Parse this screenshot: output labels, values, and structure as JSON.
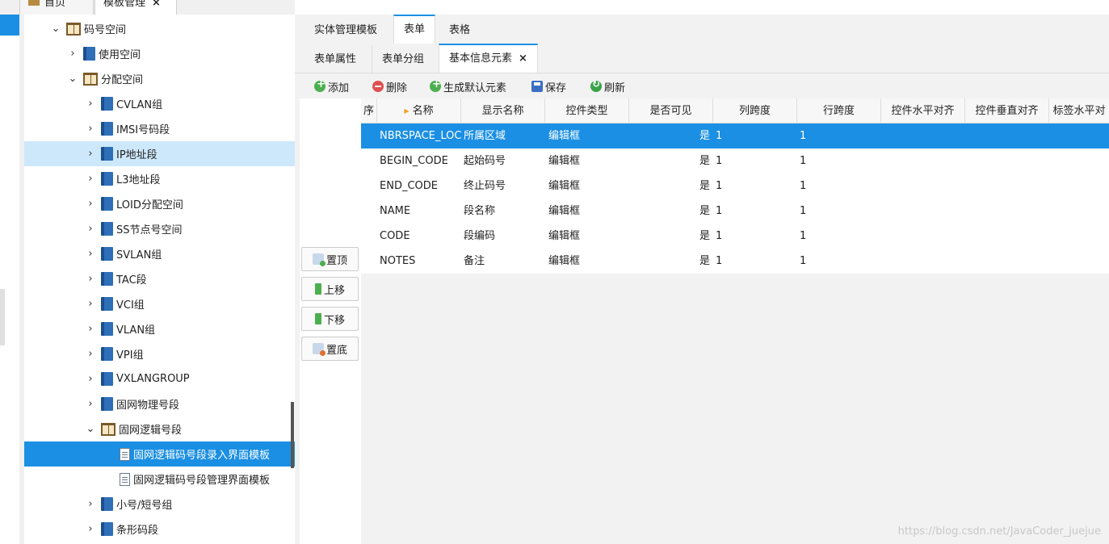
{
  "app_tabs": [
    {
      "label": "首页"
    },
    {
      "label": "模板管理",
      "close": "×"
    }
  ],
  "tree": [
    {
      "label": "码号空间",
      "expanded": true,
      "icon": "book-icon"
    },
    {
      "label": "使用空间",
      "icon": "blue-book-icon"
    },
    {
      "label": "分配空间",
      "expanded": true,
      "icon": "book-icon"
    },
    {
      "label": "CVLAN组",
      "icon": "blue-book-icon"
    },
    {
      "label": "IMSI号码段",
      "icon": "blue-book-icon"
    },
    {
      "label": "IP地址段",
      "icon": "blue-book-icon"
    },
    {
      "label": "L3地址段",
      "icon": "blue-book-icon"
    },
    {
      "label": "LOID分配空间",
      "icon": "blue-book-icon"
    },
    {
      "label": "SS节点号空间",
      "icon": "blue-book-icon"
    },
    {
      "label": "SVLAN组",
      "icon": "blue-book-icon"
    },
    {
      "label": "TAC段",
      "icon": "blue-book-icon"
    },
    {
      "label": "VCI组",
      "icon": "blue-book-icon"
    },
    {
      "label": "VLAN组",
      "icon": "blue-book-icon"
    },
    {
      "label": "VPI组",
      "icon": "blue-book-icon"
    },
    {
      "label": "VXLANGROUP",
      "icon": "blue-book-icon"
    },
    {
      "label": "固网物理号段",
      "icon": "blue-book-icon"
    },
    {
      "label": "固网逻辑号段",
      "expanded": true,
      "icon": "book-icon"
    },
    {
      "label": "固网逻辑码号段录入界面模板",
      "icon": "doc-icon"
    },
    {
      "label": "固网逻辑码号段管理界面模板",
      "icon": "doc-icon"
    },
    {
      "label": "小号/短号组",
      "icon": "blue-book-icon"
    },
    {
      "label": "条形码段",
      "icon": "blue-book-icon"
    }
  ],
  "tabs": [
    "实体管理模板",
    "表单",
    "表格"
  ],
  "subtabs": [
    "表单属性",
    "表单分组",
    "基本信息元素"
  ],
  "subtab_close": "×",
  "toolbar": {
    "add": "添加",
    "delete": "删除",
    "generate": "生成默认元素",
    "save": "保存",
    "refresh": "刷新"
  },
  "move_buttons": {
    "top": "置顶",
    "up": "上移",
    "down": "下移",
    "bottom": "置底"
  },
  "grid": {
    "headers": [
      "序",
      "名称",
      "显示名称",
      "控件类型",
      "是否可见",
      "列跨度",
      "行跨度",
      "控件水平对齐",
      "控件垂直对齐",
      "标签水平对"
    ],
    "rows": [
      [
        "NBRSPACE_LOC",
        "所属区域",
        "编辑框",
        "是",
        "1",
        "1"
      ],
      [
        "BEGIN_CODE",
        "起始码号",
        "编辑框",
        "是",
        "1",
        "1"
      ],
      [
        "END_CODE",
        "终止码号",
        "编辑框",
        "是",
        "1",
        "1"
      ],
      [
        "NAME",
        "段名称",
        "编辑框",
        "是",
        "1",
        "1"
      ],
      [
        "CODE",
        "段编码",
        "编辑框",
        "是",
        "1",
        "1"
      ],
      [
        "NOTES",
        "备注",
        "编辑框",
        "是",
        "1",
        "1"
      ]
    ]
  },
  "watermark": "https://blog.csdn.net/JavaCoder_juejue"
}
